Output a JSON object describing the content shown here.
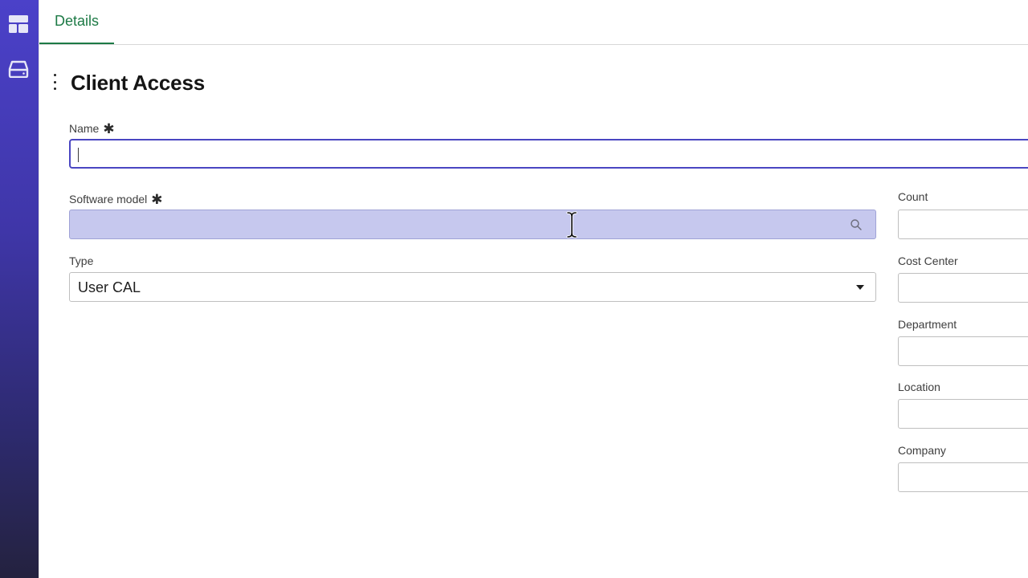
{
  "rail": {
    "items": [
      {
        "icon": "dashboard-layout-icon"
      },
      {
        "icon": "inbox-tray-icon"
      }
    ]
  },
  "tabs": [
    {
      "label": "Details",
      "active": true
    }
  ],
  "header": {
    "title": "Client Access"
  },
  "form": {
    "name": {
      "label": "Name",
      "required_mark": "✱",
      "value": ""
    },
    "software_model": {
      "label": "Software model",
      "required_mark": "✱",
      "value": ""
    },
    "type": {
      "label": "Type",
      "value": "User CAL"
    },
    "count": {
      "label": "Count",
      "value": ""
    },
    "cost_center": {
      "label": "Cost Center",
      "value": ""
    },
    "department": {
      "label": "Department",
      "value": ""
    },
    "location": {
      "label": "Location",
      "value": ""
    },
    "company": {
      "label": "Company",
      "value": ""
    }
  },
  "colors": {
    "rail_top": "#4b41c9",
    "rail_bottom": "#24223f",
    "tab_accent": "#1d7a46",
    "focus_border": "#4a46c2",
    "highlight_fill": "#c6c8ee"
  }
}
